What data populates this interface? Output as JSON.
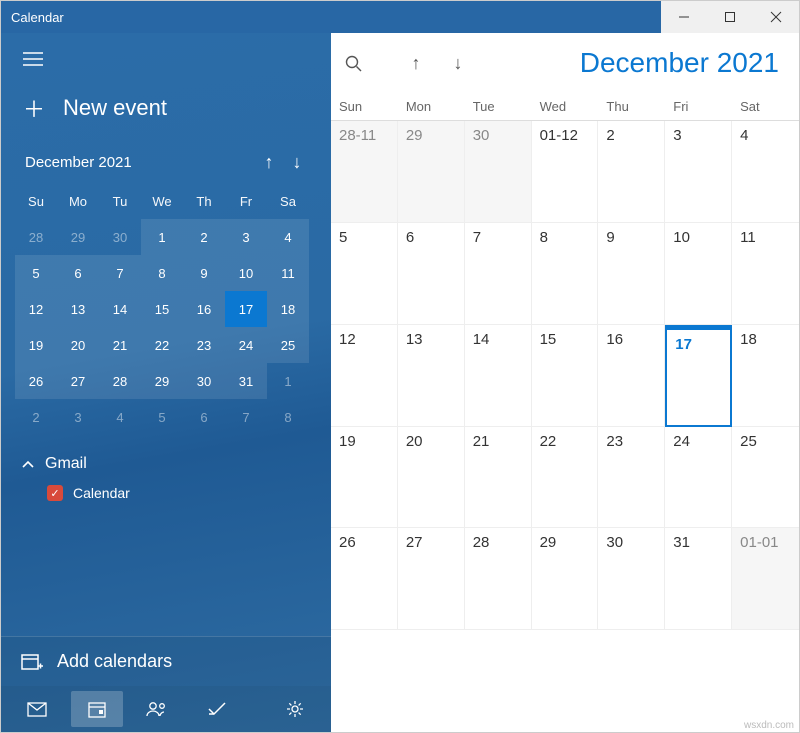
{
  "window": {
    "title": "Calendar"
  },
  "sidebar": {
    "new_event": "New event",
    "mini_title": "December 2021",
    "mini_heads": [
      "Su",
      "Mo",
      "Tu",
      "We",
      "Th",
      "Fr",
      "Sa"
    ],
    "mini_weeks": [
      [
        {
          "d": "28",
          "dim": true
        },
        {
          "d": "29",
          "dim": true
        },
        {
          "d": "30",
          "dim": true
        },
        {
          "d": "1",
          "box": true
        },
        {
          "d": "2",
          "box": true
        },
        {
          "d": "3",
          "box": true
        },
        {
          "d": "4",
          "box": true
        }
      ],
      [
        {
          "d": "5",
          "box": true
        },
        {
          "d": "6",
          "box": true
        },
        {
          "d": "7",
          "box": true
        },
        {
          "d": "8",
          "box": true
        },
        {
          "d": "9",
          "box": true
        },
        {
          "d": "10",
          "box": true
        },
        {
          "d": "11",
          "box": true
        }
      ],
      [
        {
          "d": "12",
          "box": true
        },
        {
          "d": "13",
          "box": true
        },
        {
          "d": "14",
          "box": true
        },
        {
          "d": "15",
          "box": true
        },
        {
          "d": "16",
          "box": true
        },
        {
          "d": "17",
          "box": true,
          "today": true
        },
        {
          "d": "18",
          "box": true
        }
      ],
      [
        {
          "d": "19",
          "box": true
        },
        {
          "d": "20",
          "box": true
        },
        {
          "d": "21",
          "box": true
        },
        {
          "d": "22",
          "box": true
        },
        {
          "d": "23",
          "box": true
        },
        {
          "d": "24",
          "box": true
        },
        {
          "d": "25",
          "box": true
        }
      ],
      [
        {
          "d": "26",
          "box": true
        },
        {
          "d": "27",
          "box": true
        },
        {
          "d": "28",
          "box": true
        },
        {
          "d": "29",
          "box": true
        },
        {
          "d": "30",
          "box": true
        },
        {
          "d": "31",
          "box": true
        },
        {
          "d": "1",
          "dim": true
        }
      ],
      [
        {
          "d": "2",
          "dim": true
        },
        {
          "d": "3",
          "dim": true
        },
        {
          "d": "4",
          "dim": true
        },
        {
          "d": "5",
          "dim": true
        },
        {
          "d": "6",
          "dim": true
        },
        {
          "d": "7",
          "dim": true
        },
        {
          "d": "8",
          "dim": true
        }
      ]
    ],
    "account": "Gmail",
    "calendar_item": "Calendar",
    "add_calendars": "Add calendars"
  },
  "main": {
    "title": "December 2021",
    "day_heads": [
      "Sun",
      "Mon",
      "Tue",
      "Wed",
      "Thu",
      "Fri",
      "Sat"
    ],
    "weeks": [
      [
        {
          "d": "28-11",
          "dim": true
        },
        {
          "d": "29",
          "dim": true
        },
        {
          "d": "30",
          "dim": true
        },
        {
          "d": "01-12"
        },
        {
          "d": "2"
        },
        {
          "d": "3"
        },
        {
          "d": "4"
        }
      ],
      [
        {
          "d": "5"
        },
        {
          "d": "6"
        },
        {
          "d": "7"
        },
        {
          "d": "8"
        },
        {
          "d": "9"
        },
        {
          "d": "10"
        },
        {
          "d": "11"
        }
      ],
      [
        {
          "d": "12"
        },
        {
          "d": "13"
        },
        {
          "d": "14"
        },
        {
          "d": "15"
        },
        {
          "d": "16"
        },
        {
          "d": "17",
          "today": true
        },
        {
          "d": "18"
        }
      ],
      [
        {
          "d": "19"
        },
        {
          "d": "20"
        },
        {
          "d": "21"
        },
        {
          "d": "22"
        },
        {
          "d": "23"
        },
        {
          "d": "24"
        },
        {
          "d": "25"
        }
      ],
      [
        {
          "d": "26"
        },
        {
          "d": "27"
        },
        {
          "d": "28"
        },
        {
          "d": "29"
        },
        {
          "d": "30"
        },
        {
          "d": "31"
        },
        {
          "d": "01-01",
          "dim": true
        }
      ]
    ]
  },
  "watermark": "wsxdn.com"
}
